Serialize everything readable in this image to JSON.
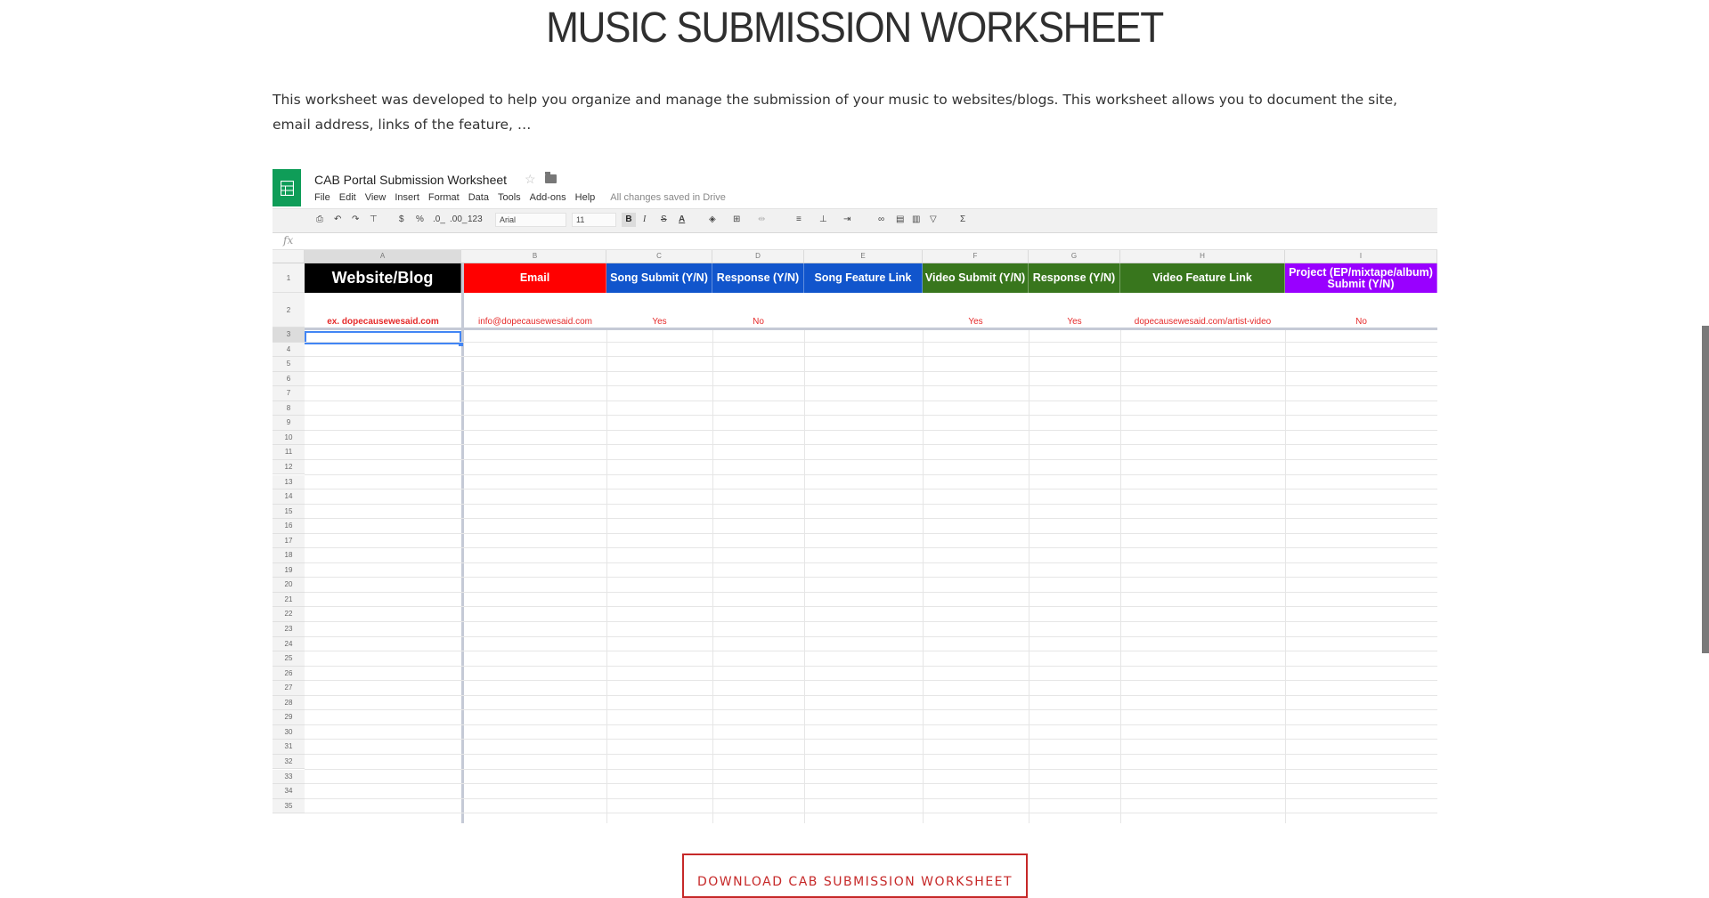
{
  "page": {
    "title": "MUSIC SUBMISSION WORKSHEET",
    "intro": "This worksheet was developed to help you organize and manage the submission of your music to websites/blogs. This worksheet allows you to document the site, email address, links of the feature, …",
    "download_button": "DOWNLOAD CAB SUBMISSION WORKSHEET"
  },
  "sheet": {
    "title": "CAB Portal Submission Worksheet",
    "menu": [
      "File",
      "Edit",
      "View",
      "Insert",
      "Format",
      "Data",
      "Tools",
      "Add-ons",
      "Help"
    ],
    "saved_status": "All changes saved in Drive",
    "toolbar": {
      "currency": "$",
      "percent": "%",
      "decrease_decimal": ".0_",
      "increase_decimal": ".00_",
      "number_format": "123",
      "font": "Arial",
      "font_size": "11",
      "bold": "B",
      "italic": "I",
      "strikethrough": "S",
      "text_color": "A",
      "sum": "Σ"
    },
    "fx_label": "fx",
    "columns": [
      "A",
      "B",
      "C",
      "D",
      "E",
      "F",
      "G",
      "H",
      "I"
    ],
    "headers": [
      {
        "text": "Website/Blog",
        "color": "#000000"
      },
      {
        "text": "Email",
        "color": "#ff0000"
      },
      {
        "text": "Song Submit (Y/N)",
        "color": "#1155cc"
      },
      {
        "text": "Response (Y/N)",
        "color": "#1155cc"
      },
      {
        "text": "Song Feature Link",
        "color": "#1155cc"
      },
      {
        "text": "Video Submit (Y/N)",
        "color": "#38761d"
      },
      {
        "text": "Response (Y/N)",
        "color": "#38761d"
      },
      {
        "text": "Video Feature Link",
        "color": "#38761d"
      },
      {
        "text": "Project (EP/mixtape/album) Submit (Y/N)",
        "color": "#9900ff"
      }
    ],
    "example_row": [
      "ex. dopecausewesaid.com",
      "info@dopecausewesaid.com",
      "Yes",
      "No",
      "",
      "Yes",
      "Yes",
      "dopecausewesaid.com/artist-video",
      "No"
    ],
    "row_numbers": [
      "1",
      "2",
      "3",
      "4",
      "5",
      "6",
      "7",
      "8",
      "9",
      "10",
      "11",
      "12",
      "13",
      "14",
      "15",
      "16",
      "17",
      "18",
      "19",
      "20",
      "21",
      "22",
      "23",
      "24",
      "25",
      "26",
      "27",
      "28",
      "29",
      "30",
      "31",
      "32",
      "33",
      "34",
      "35"
    ]
  },
  "colors": {
    "sheets_green": "#0f9d58",
    "selection_blue": "#4285f4",
    "button_red": "#c62828",
    "example_text_red": "#e52a2a"
  }
}
